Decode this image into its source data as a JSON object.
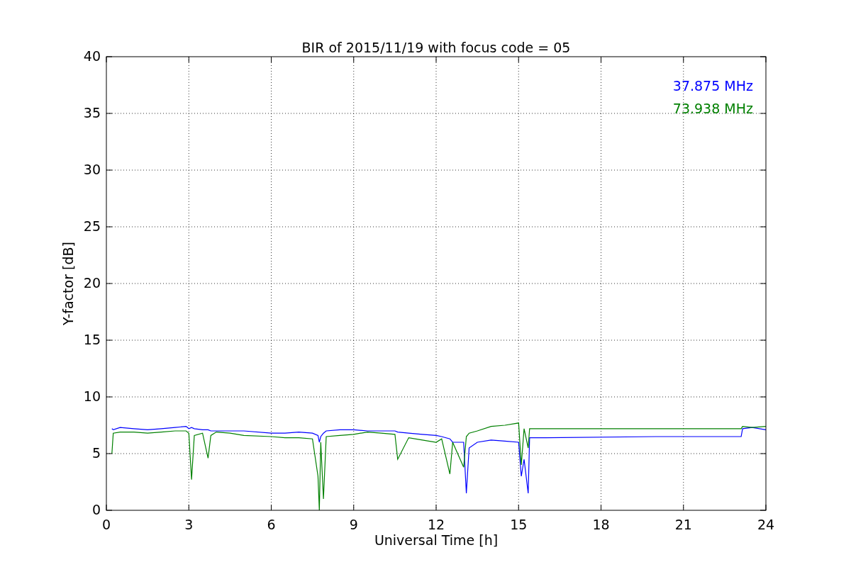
{
  "chart": {
    "chart_data": {
      "type": "line",
      "title": "BIR of 2015/11/19 with focus code = 05",
      "xlabel": "Universal Time [h]",
      "ylabel": "Y-factor [dB]",
      "x": [
        0.2,
        0.25,
        0.5,
        1,
        1.5,
        2,
        2.5,
        2.9,
        3.0,
        3.1,
        3.2,
        3.5,
        3.7,
        3.8,
        4,
        4.5,
        5,
        6,
        6.5,
        7,
        7.5,
        7.7,
        7.75,
        7.8,
        7.9,
        8,
        8.5,
        9,
        9.5,
        10,
        10.5,
        10.6,
        11,
        11.5,
        12,
        12.2,
        12.5,
        12.6,
        13,
        13.1,
        13.2,
        13.5,
        14,
        14.5,
        15,
        15.1,
        15.2,
        15.35,
        15.4,
        16,
        20,
        23.1,
        23.15,
        23.5,
        24
      ],
      "series": [
        {
          "name": "37.875 MHz",
          "color": "#0000ff",
          "values": [
            7.2,
            7.1,
            7.3,
            7.2,
            7.1,
            7.2,
            7.3,
            7.4,
            7.2,
            7.3,
            7.2,
            7.1,
            7.1,
            7.0,
            7.0,
            7.0,
            7.0,
            6.8,
            6.8,
            6.9,
            6.8,
            6.6,
            6.0,
            6.5,
            6.8,
            7.0,
            7.1,
            7.1,
            7.0,
            7.0,
            7.0,
            6.9,
            6.8,
            6.7,
            6.6,
            6.5,
            6.3,
            6.0,
            6.0,
            1.5,
            5.5,
            6.0,
            6.2,
            6.1,
            6.0,
            3.0,
            4.5,
            1.5,
            6.4,
            6.4,
            6.5,
            6.5,
            7.2,
            7.3,
            7.1
          ]
        },
        {
          "name": "73.938 MHz",
          "color": "#008000",
          "values": [
            5.0,
            6.8,
            6.9,
            6.9,
            6.8,
            6.9,
            7.0,
            7.0,
            6.8,
            2.7,
            6.6,
            6.8,
            4.6,
            6.6,
            6.9,
            6.8,
            6.6,
            6.5,
            6.4,
            6.4,
            6.3,
            3.0,
            0.0,
            6.0,
            1.0,
            6.5,
            6.6,
            6.7,
            6.9,
            6.8,
            6.7,
            4.5,
            6.4,
            6.2,
            6.0,
            6.3,
            3.2,
            6.0,
            3.8,
            6.5,
            6.8,
            7.0,
            7.4,
            7.5,
            7.7,
            4.0,
            7.2,
            5.5,
            7.2,
            7.2,
            7.2,
            7.2,
            7.4,
            7.3,
            7.4
          ]
        }
      ],
      "xlim": [
        0,
        24
      ],
      "ylim": [
        0,
        40
      ],
      "xticks": [
        0,
        3,
        6,
        9,
        12,
        15,
        18,
        21,
        24
      ],
      "yticks": [
        0,
        5,
        10,
        15,
        20,
        25,
        30,
        35,
        40
      ],
      "grid": true
    }
  }
}
